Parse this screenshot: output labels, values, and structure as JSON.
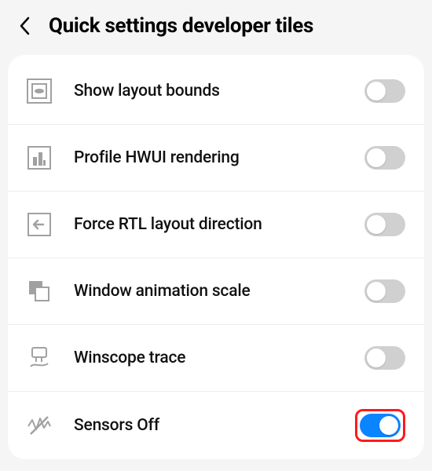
{
  "header": {
    "title": "Quick settings developer tiles"
  },
  "items": [
    {
      "icon": "layout-bounds-icon",
      "label": "Show layout bounds",
      "enabled": false,
      "highlighted": false
    },
    {
      "icon": "profile-hwui-icon",
      "label": "Profile HWUI rendering",
      "enabled": false,
      "highlighted": false
    },
    {
      "icon": "rtl-icon",
      "label": "Force RTL layout direction",
      "enabled": false,
      "highlighted": false
    },
    {
      "icon": "window-anim-icon",
      "label": "Window animation scale",
      "enabled": false,
      "highlighted": false
    },
    {
      "icon": "winscope-icon",
      "label": "Winscope trace",
      "enabled": false,
      "highlighted": false
    },
    {
      "icon": "sensors-off-icon",
      "label": "Sensors Off",
      "enabled": true,
      "highlighted": true
    }
  ]
}
